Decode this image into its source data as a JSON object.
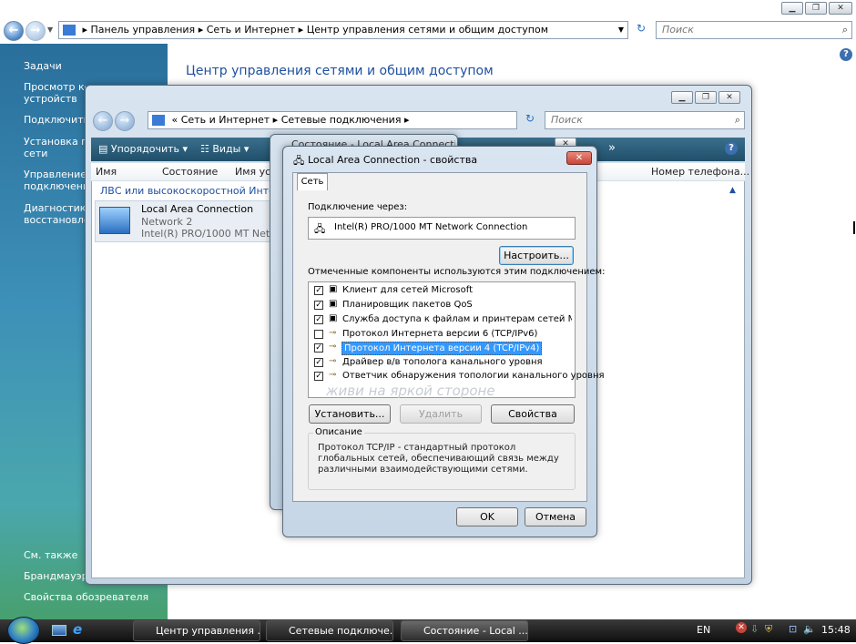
{
  "explorer": {
    "address": [
      "Панель управления",
      "Сеть и Интернет",
      "Центр управления сетями и общим доступом"
    ],
    "search_placeholder": "Поиск",
    "page_title": "Центр управления сетями и общим доступом",
    "sidebar_tasks_heading": "Задачи",
    "sidebar_tasks": [
      "Просмотр ко...",
      "устройств",
      "Подключить...",
      "Установка по...",
      "сети",
      "Управление с...",
      "подключени...",
      "Диагностика...",
      "восстановлен..."
    ],
    "see_also_heading": "См. также",
    "see_also": [
      "Брандмауэр W...",
      "Свойства обозревателя"
    ]
  },
  "netconn_window": {
    "address": [
      "Сеть и Интернет",
      "Сетевые подключения"
    ],
    "search_placeholder": "Поиск",
    "toolbar": {
      "organize": "Упорядочить",
      "views": "Виды",
      "more": "»"
    },
    "columns": [
      "Имя",
      "Состояние",
      "Имя уст...",
      "Номер телефона..."
    ],
    "group_header": "ЛВС или высокоскоростной Интерне...",
    "connection": {
      "name": "Local Area Connection",
      "network": "Network 2",
      "adapter": "Intel(R) PRO/1000 MT Netw..."
    }
  },
  "status_window": {
    "title": "Состояние - Local Area Connection"
  },
  "dialog": {
    "title": "Local Area Connection - свойства",
    "tab": "Сеть",
    "connect_using_label": "Подключение через:",
    "adapter": "Intel(R) PRO/1000 MT Network Connection",
    "configure_button": "Настроить...",
    "components_label": "Отмеченные компоненты используются этим подключением:",
    "components": [
      {
        "label": "Клиент для сетей Microsoft",
        "checked": true
      },
      {
        "label": "Планировщик пакетов QoS",
        "checked": true
      },
      {
        "label": "Служба доступа к файлам и принтерам сетей Micro...",
        "checked": true
      },
      {
        "label": "Протокол Интернета версии 6 (TCP/IPv6)",
        "checked": false
      },
      {
        "label": "Протокол Интернета версии 4 (TCP/IPv4)",
        "checked": true,
        "selected": true
      },
      {
        "label": "Драйвер в/в тополога канального уровня",
        "checked": true
      },
      {
        "label": "Ответчик обнаружения топологии канального уровня",
        "checked": true
      }
    ],
    "install_button": "Установить...",
    "remove_button": "Удалить",
    "properties_button": "Свойства",
    "description_heading": "Описание",
    "description": "Протокол TCP/IP - стандартный протокол глобальных сетей, обеспечивающий связь между различными взаимодействующими сетями.",
    "ok_button": "OK",
    "cancel_button": "Отмена",
    "watermark": "живи на яркой стороне"
  },
  "taskbar": {
    "items": [
      "Центр управления ...",
      "Сетевые подключе...",
      "Состояние - Local ..."
    ],
    "language": "EN",
    "clock": "15:48"
  },
  "colors": {
    "sidebar": "#3d90b8",
    "selection": "#3399ff",
    "title_link": "#1e50a0",
    "close_red": "#c9443a"
  }
}
